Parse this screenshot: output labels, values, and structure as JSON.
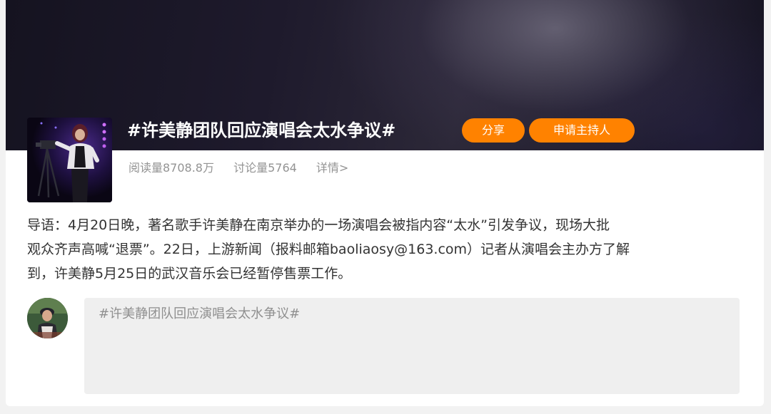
{
  "topic": {
    "title": "#许美静团队回应演唱会太水争议#",
    "share_label": "分享",
    "host_label": "申请主持人",
    "reads": "阅读量8708.8万",
    "discussions": "讨论量5764",
    "details_label": "详情>"
  },
  "lead": {
    "lines": [
      "导语：4月20日晚，著名歌手许美静在南京举办的一场演唱会被指内容“太水”引发争议，现场大批",
      "观众齐声高喊“退票”。22日，上游新闻（报料邮箱baoliaosy@163.com）记者从演唱会主办方了解",
      "到，许美静5月25日的武汉音乐会已经暂停售票工作。"
    ]
  },
  "composer": {
    "placeholder": "#许美静团队回应演唱会太水争议#",
    "value": ""
  },
  "colors": {
    "accent": "#ff8200",
    "stats_text": "#939393",
    "body_text": "#333333",
    "compose_bg": "#efefef"
  },
  "icons": {
    "topic_cover": "topic-cover-image",
    "avatar": "user-avatar"
  }
}
